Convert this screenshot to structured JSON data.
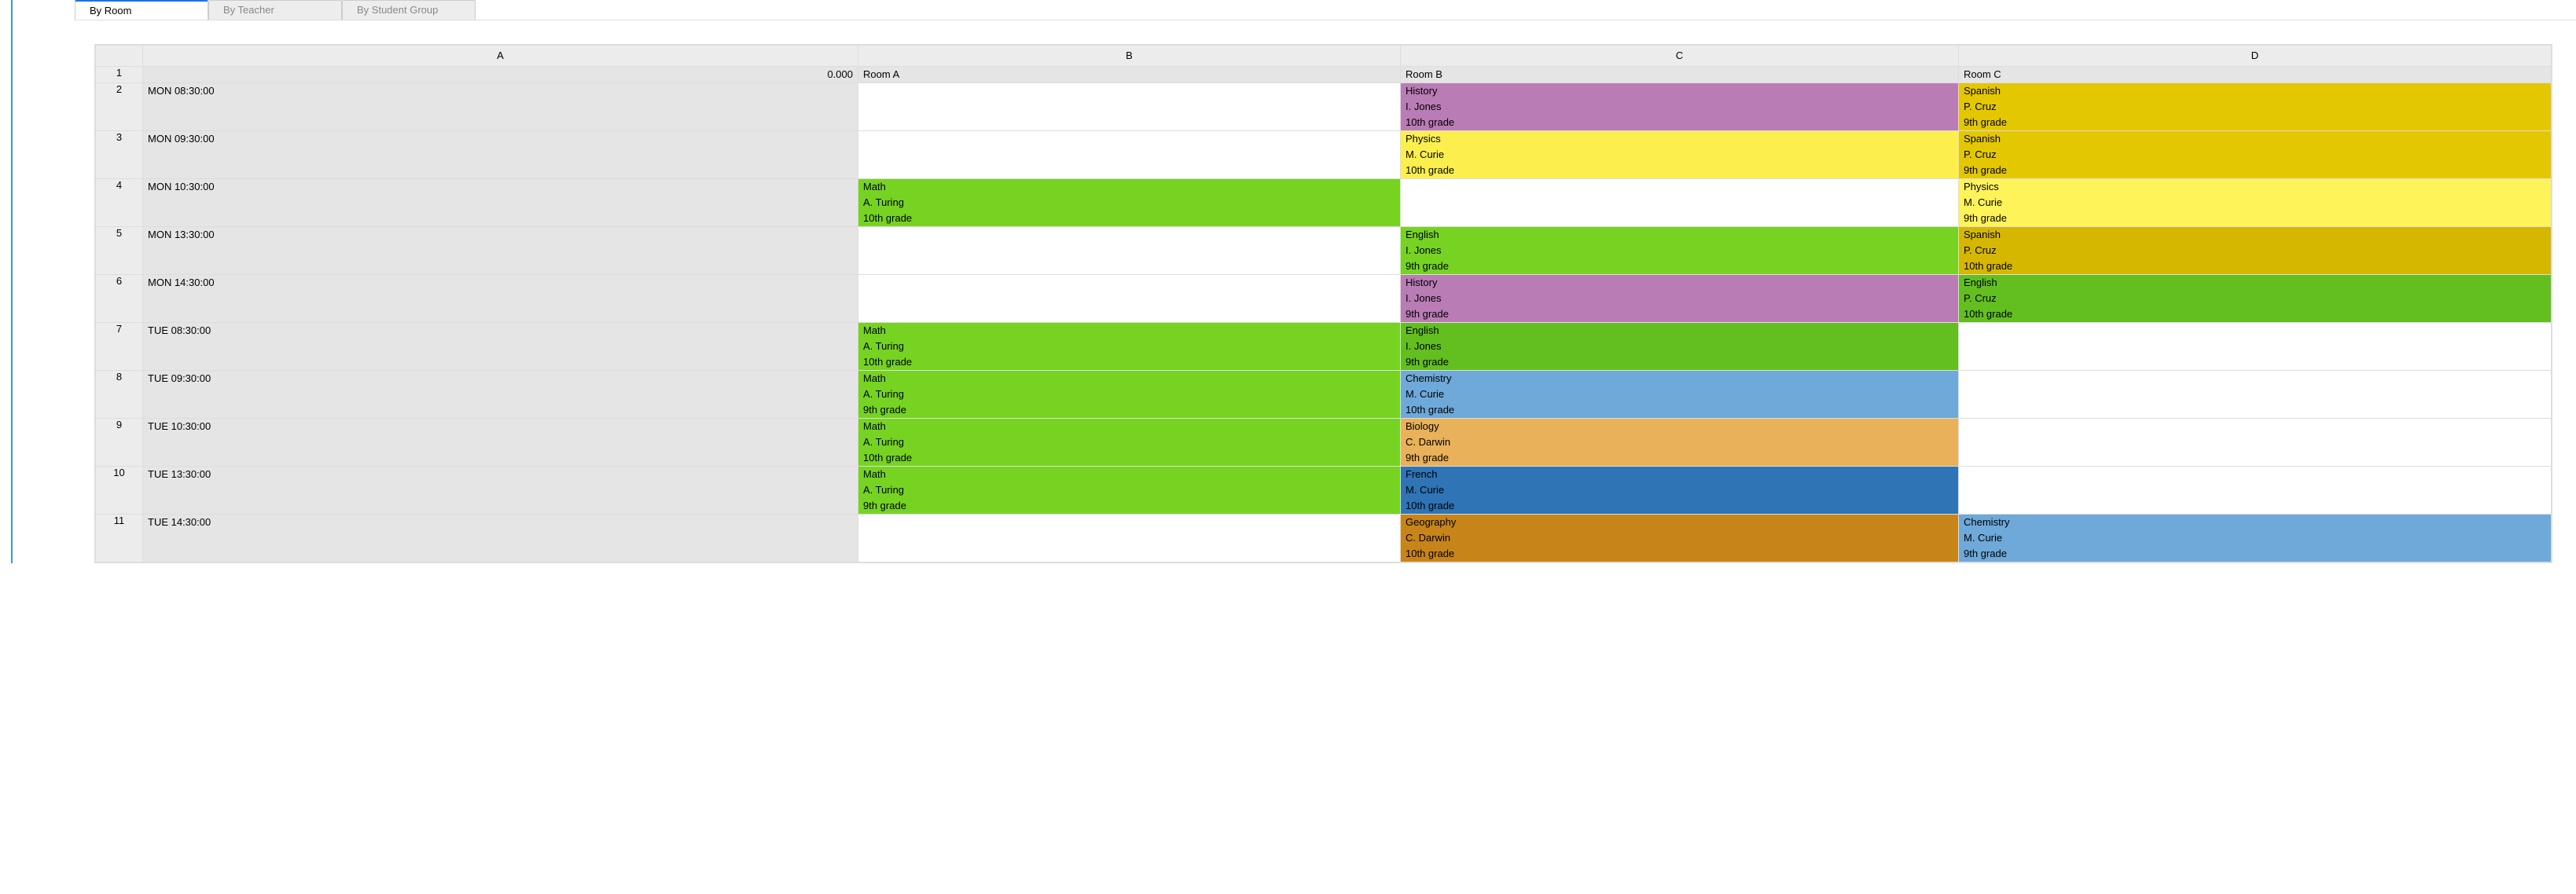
{
  "tabs": {
    "by_room": "By Room",
    "by_teacher": "By Teacher",
    "by_student_group": "By Student Group"
  },
  "columns": {
    "A": "A",
    "B": "B",
    "C": "C",
    "D": "D"
  },
  "row_numbers": [
    "1",
    "2",
    "3",
    "4",
    "5",
    "6",
    "7",
    "8",
    "9",
    "10",
    "11"
  ],
  "row1": {
    "A": "0.000",
    "B": "Room A",
    "C": "Room B",
    "D": "Room C"
  },
  "rows": [
    {
      "time": "MON 08:30:00",
      "B": null,
      "C": {
        "subj": "History",
        "teacher": "I. Jones",
        "grade": "10th grade",
        "color": "c-purple"
      },
      "D": {
        "subj": "Spanish",
        "teacher": "P. Cruz",
        "grade": "9th grade",
        "color": "c-gold"
      }
    },
    {
      "time": "MON 09:30:00",
      "B": null,
      "C": {
        "subj": "Physics",
        "teacher": "M. Curie",
        "grade": "10th grade",
        "color": "c-yellow"
      },
      "D": {
        "subj": "Spanish",
        "teacher": "P. Cruz",
        "grade": "9th grade",
        "color": "c-gold"
      }
    },
    {
      "time": "MON 10:30:00",
      "B": {
        "subj": "Math",
        "teacher": "A. Turing",
        "grade": "10th grade",
        "color": "c-green"
      },
      "C": null,
      "D": {
        "subj": "Physics",
        "teacher": "M. Curie",
        "grade": "9th grade",
        "color": "c-physics"
      }
    },
    {
      "time": "MON 13:30:00",
      "B": null,
      "C": {
        "subj": "English",
        "teacher": "I. Jones",
        "grade": "9th grade",
        "color": "c-green"
      },
      "D": {
        "subj": "Spanish",
        "teacher": "P. Cruz",
        "grade": "10th grade",
        "color": "c-gold2"
      }
    },
    {
      "time": "MON 14:30:00",
      "B": null,
      "C": {
        "subj": "History",
        "teacher": "I. Jones",
        "grade": "9th grade",
        "color": "c-purple"
      },
      "D": {
        "subj": "English",
        "teacher": "P. Cruz",
        "grade": "10th grade",
        "color": "c-green2"
      }
    },
    {
      "time": "TUE 08:30:00",
      "B": {
        "subj": "Math",
        "teacher": "A. Turing",
        "grade": "10th grade",
        "color": "c-green"
      },
      "C": {
        "subj": "English",
        "teacher": "I. Jones",
        "grade": "9th grade",
        "color": "c-green2"
      },
      "D": null
    },
    {
      "time": "TUE 09:30:00",
      "B": {
        "subj": "Math",
        "teacher": "A. Turing",
        "grade": "9th grade",
        "color": "c-green"
      },
      "C": {
        "subj": "Chemistry",
        "teacher": "M. Curie",
        "grade": "10th grade",
        "color": "c-blue"
      },
      "D": null
    },
    {
      "time": "TUE 10:30:00",
      "B": {
        "subj": "Math",
        "teacher": "A. Turing",
        "grade": "10th grade",
        "color": "c-green"
      },
      "C": {
        "subj": "Biology",
        "teacher": "C. Darwin",
        "grade": "9th grade",
        "color": "c-orange"
      },
      "D": null
    },
    {
      "time": "TUE 13:30:00",
      "B": {
        "subj": "Math",
        "teacher": "A. Turing",
        "grade": "9th grade",
        "color": "c-green"
      },
      "C": {
        "subj": "French",
        "teacher": "M. Curie",
        "grade": "10th grade",
        "color": "c-navy"
      },
      "D": null
    },
    {
      "time": "TUE 14:30:00",
      "B": null,
      "C": {
        "subj": "Geography",
        "teacher": "C. Darwin",
        "grade": "10th grade",
        "color": "c-brown"
      },
      "D": {
        "subj": "Chemistry",
        "teacher": "M. Curie",
        "grade": "9th grade",
        "color": "c-blue"
      }
    }
  ]
}
